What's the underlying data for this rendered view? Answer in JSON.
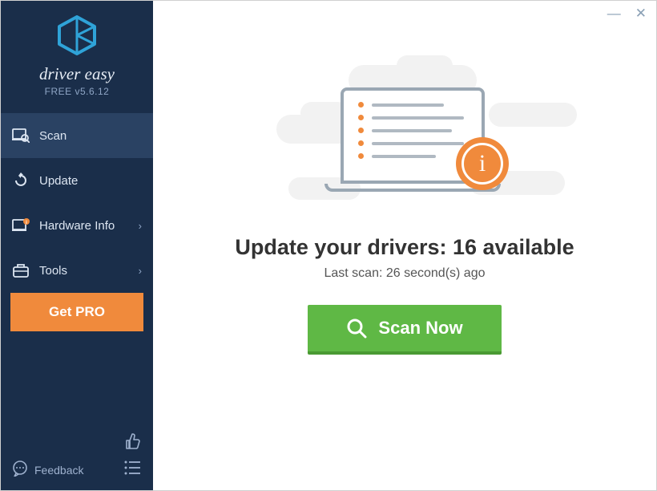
{
  "brand": {
    "name": "driver easy",
    "version": "FREE v5.6.12"
  },
  "nav": {
    "scan": "Scan",
    "update": "Update",
    "hardware": "Hardware Info",
    "tools": "Tools"
  },
  "sidebar": {
    "get_pro": "Get PRO",
    "feedback": "Feedback"
  },
  "main": {
    "headline": "Update your drivers: 16 available",
    "subline": "Last scan: 26 second(s) ago",
    "scan_button": "Scan Now"
  }
}
